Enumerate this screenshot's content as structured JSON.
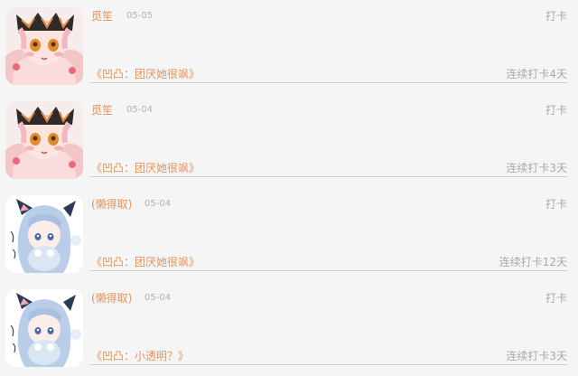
{
  "posts": [
    {
      "user": "觅笙",
      "date": "05-05",
      "action": "打卡",
      "work_title": "《凹凸：团厌她很飒》",
      "streak": "连续打卡4天",
      "avatar_icon": "anime-girl-pink-hair-avatar"
    },
    {
      "user": "觅笙",
      "date": "05-04",
      "action": "打卡",
      "work_title": "《凹凸：团厌她很飒》",
      "streak": "连续打卡3天",
      "avatar_icon": "anime-girl-pink-hair-avatar"
    },
    {
      "user": "(懒得取)",
      "date": "05-04",
      "action": "打卡",
      "work_title": "《凹凸：团厌她很飒》",
      "streak": "连续打卡12天",
      "avatar_icon": "anime-girl-blue-hair-cat-ears-avatar"
    },
    {
      "user": "(懒得取)",
      "date": "05-04",
      "action": "打卡",
      "work_title": "《凹凸：小透明？》",
      "streak": "连续打卡3天",
      "avatar_icon": "anime-girl-blue-hair-cat-ears-avatar"
    }
  ],
  "colors": {
    "accent": "#e8945a",
    "muted": "#a9a9a9",
    "background": "#f5f5f5"
  }
}
